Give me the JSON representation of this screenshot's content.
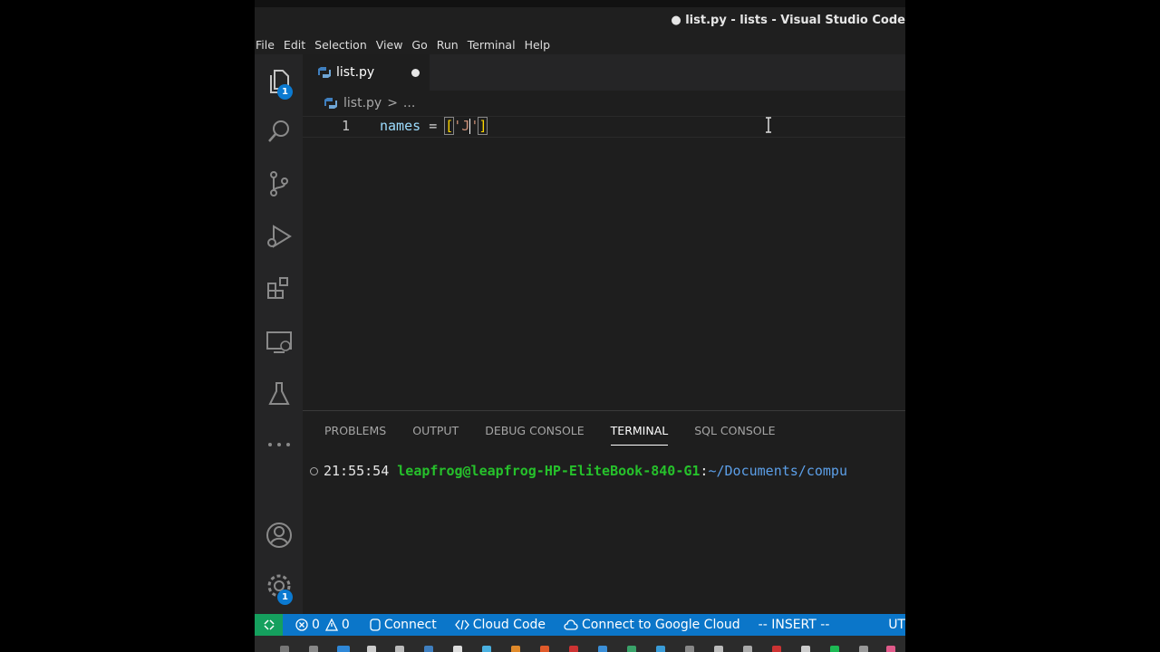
{
  "window": {
    "title": "● list.py - lists - Visual Studio Code"
  },
  "menu": [
    "File",
    "Edit",
    "Selection",
    "View",
    "Go",
    "Run",
    "Terminal",
    "Help"
  ],
  "activity": {
    "explorer_badge": "1",
    "settings_badge": "1"
  },
  "tab": {
    "label": "list.py"
  },
  "breadcrumb": {
    "file": "list.py",
    "separator": ">",
    "more": "..."
  },
  "editor": {
    "line_number": "1",
    "code": {
      "var": "names",
      "assign": "=",
      "open": "[",
      "quote1": "'",
      "text": "J",
      "quote2": "'",
      "close": "]"
    }
  },
  "panel": {
    "tabs": [
      "PROBLEMS",
      "OUTPUT",
      "DEBUG CONSOLE",
      "TERMINAL",
      "SQL CONSOLE"
    ],
    "active_tab": "TERMINAL",
    "terminal": {
      "time": "21:55:54",
      "user_host": "leapfrog@leapfrog-HP-EliteBook-840-G1",
      "colon": ":",
      "path": "~/Documents/compu"
    }
  },
  "status": {
    "errors": "0",
    "warnings": "0",
    "connect": "Connect",
    "cloud_code": "Cloud Code",
    "google_cloud": "Connect to Google Cloud",
    "mode": "-- INSERT --",
    "encoding": "UT"
  },
  "colors": {
    "status_bar": "#0b76c9",
    "remote": "#15a05e",
    "badge": "#0b7ad1",
    "terminal_user": "#26c12b",
    "terminal_path": "#5c9fe8"
  }
}
